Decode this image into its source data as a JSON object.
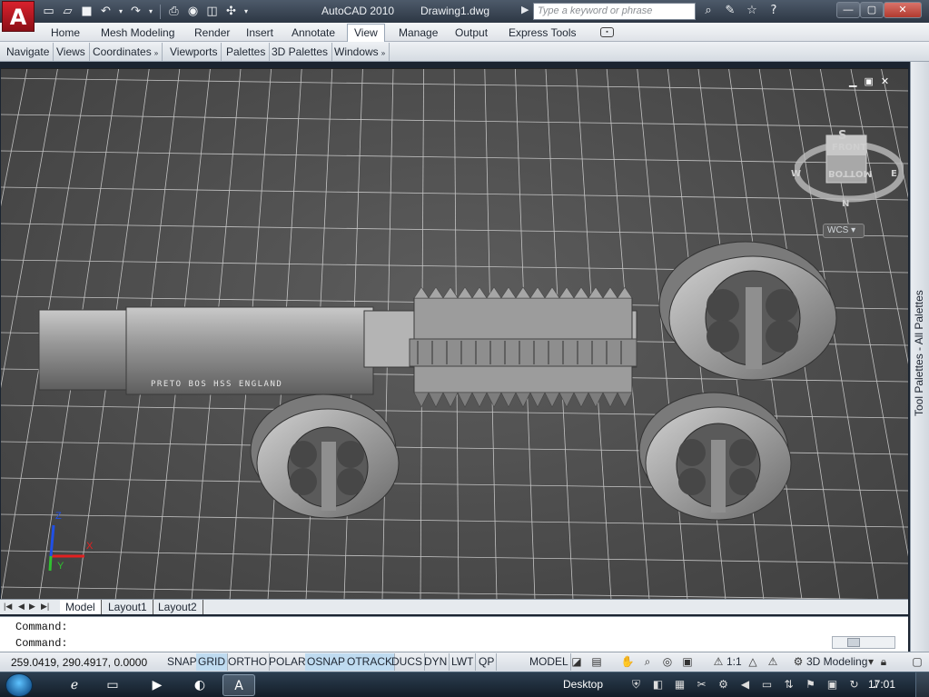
{
  "window": {
    "app_title": "AutoCAD 2010",
    "document_title": "Drawing1.dwg",
    "search_placeholder": "Type a keyword or phrase",
    "logo_letter": "A"
  },
  "quick_access": [
    "new-icon",
    "open-icon",
    "save-icon",
    "undo-icon",
    "redo-icon",
    "plot-icon",
    "workspace-icon",
    "layer-icon",
    "orbit-icon"
  ],
  "ribbon_tabs": [
    {
      "label": "Home",
      "active": false
    },
    {
      "label": "Mesh Modeling",
      "active": false
    },
    {
      "label": "Render",
      "active": false
    },
    {
      "label": "Insert",
      "active": false
    },
    {
      "label": "Annotate",
      "active": false
    },
    {
      "label": "View",
      "active": true
    },
    {
      "label": "Manage",
      "active": false
    },
    {
      "label": "Output",
      "active": false
    },
    {
      "label": "Express Tools",
      "active": false
    }
  ],
  "panels": [
    {
      "label": "Navigate"
    },
    {
      "label": "Views"
    },
    {
      "label": "Coordinates"
    },
    {
      "label": "Viewports"
    },
    {
      "label": "Palettes"
    },
    {
      "label": "3D Palettes"
    },
    {
      "label": "Windows"
    }
  ],
  "panel_more_glyph": "»",
  "viewcube": {
    "top_face": "FRONT",
    "bottom_face": "BOTTOM",
    "compass_s": "S",
    "compass_w": "W",
    "compass_e": "E",
    "compass_n": "N",
    "wcs_label": "WCS"
  },
  "ucs": {
    "x_label": "X",
    "y_label": "Y",
    "z_label": "Z"
  },
  "model_text": "PRETO BOS HSS ENGLAND",
  "tool_palette_title": "Tool Palettes - All Palettes",
  "layout_tabs": [
    {
      "label": "Model",
      "active": true
    },
    {
      "label": "Layout1",
      "active": false
    },
    {
      "label": "Layout2",
      "active": false
    }
  ],
  "command_lines": [
    "Command:",
    "Command:"
  ],
  "status": {
    "coordinates": "259.0419, 290.4917, 0.0000",
    "toggles": [
      {
        "label": "SNAP",
        "on": false
      },
      {
        "label": "GRID",
        "on": true
      },
      {
        "label": "ORTHO",
        "on": false
      },
      {
        "label": "POLAR",
        "on": false
      },
      {
        "label": "OSNAP",
        "on": true
      },
      {
        "label": "OTRACK",
        "on": true
      },
      {
        "label": "DUCS",
        "on": false
      },
      {
        "label": "DYN",
        "on": false
      },
      {
        "label": "LWT",
        "on": false
      },
      {
        "label": "QP",
        "on": false
      }
    ],
    "model_label": "MODEL",
    "scale_label": "1:1",
    "workspace": "3D Modeling"
  },
  "taskbar": {
    "desktop_label": "Desktop",
    "clock": "17:01"
  }
}
